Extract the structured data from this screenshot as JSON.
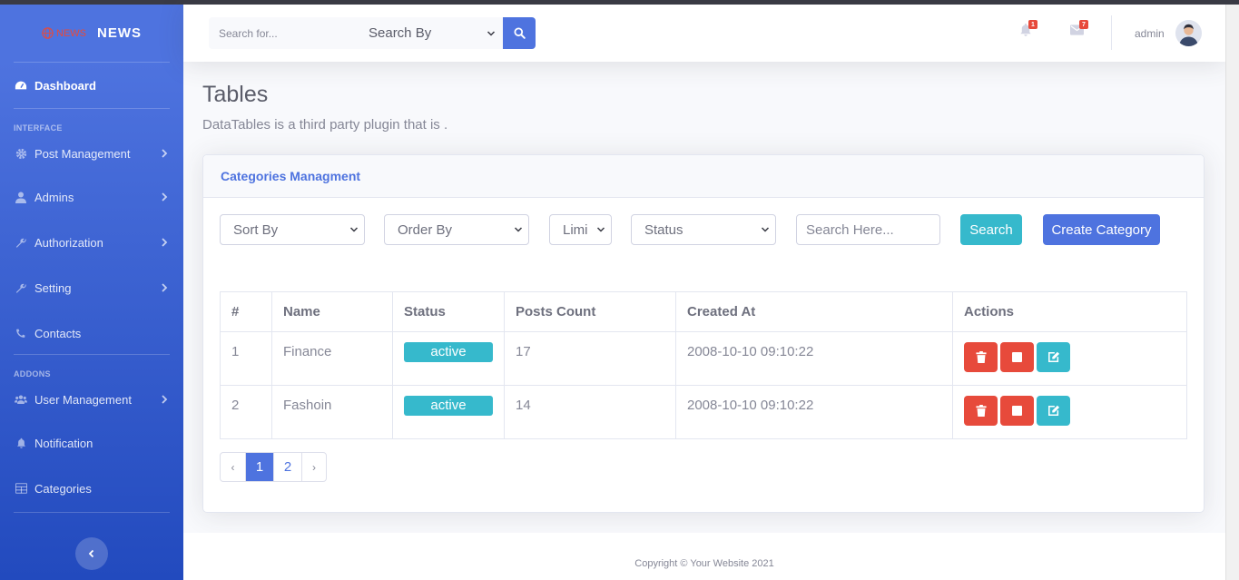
{
  "brand": {
    "logo_text": "NEWS",
    "name": "NEWS"
  },
  "sidebar": {
    "dashboard": "Dashboard",
    "heading_interface": "INTERFACE",
    "heading_addons": "ADDONS",
    "items": [
      {
        "label": "Post Management",
        "icon": "gear-icon",
        "has_submenu": true
      },
      {
        "label": "Admins",
        "icon": "user-icon",
        "has_submenu": true
      },
      {
        "label": "Authorization",
        "icon": "wrench-icon",
        "has_submenu": true
      },
      {
        "label": "Setting",
        "icon": "wrench-icon",
        "has_submenu": true
      },
      {
        "label": "Contacts",
        "icon": "phone-icon",
        "has_submenu": false
      },
      {
        "label": "User Management",
        "icon": "users-icon",
        "has_submenu": true
      },
      {
        "label": "Notification",
        "icon": "bell-icon",
        "has_submenu": false
      },
      {
        "label": "Categories",
        "icon": "table-icon",
        "has_submenu": false
      }
    ]
  },
  "topbar": {
    "search_placeholder": "Search for...",
    "search_by": "Search By",
    "alerts_count": "1",
    "messages_count": "7",
    "username": "admin"
  },
  "page": {
    "title": "Tables",
    "subtitle": "DataTables is a third party plugin that is ."
  },
  "card": {
    "title": "Categories Managment",
    "filters": {
      "sort_by": "Sort By",
      "order_by": "Order By",
      "limit": "Limi",
      "status": "Status",
      "search_placeholder": "Search Here...",
      "search_button": "Search",
      "create_button": "Create Category"
    },
    "table": {
      "headers": [
        "#",
        "Name",
        "Status",
        "Posts Count",
        "Created At",
        "Actions"
      ],
      "rows": [
        {
          "id": "1",
          "name": "Finance",
          "status": "active",
          "posts_count": "17",
          "created_at": "2008-10-10 09:10:22"
        },
        {
          "id": "2",
          "name": "Fashoin",
          "status": "active",
          "posts_count": "14",
          "created_at": "2008-10-10 09:10:22"
        }
      ]
    },
    "pagination": {
      "prev": "‹",
      "pages": [
        "1",
        "2"
      ],
      "current": "1",
      "next": "›"
    }
  },
  "footer": {
    "copyright": "Copyright © Your Website 2021"
  },
  "colors": {
    "primary": "#4e73df",
    "info": "#36b9cc",
    "danger": "#e74a3b"
  }
}
